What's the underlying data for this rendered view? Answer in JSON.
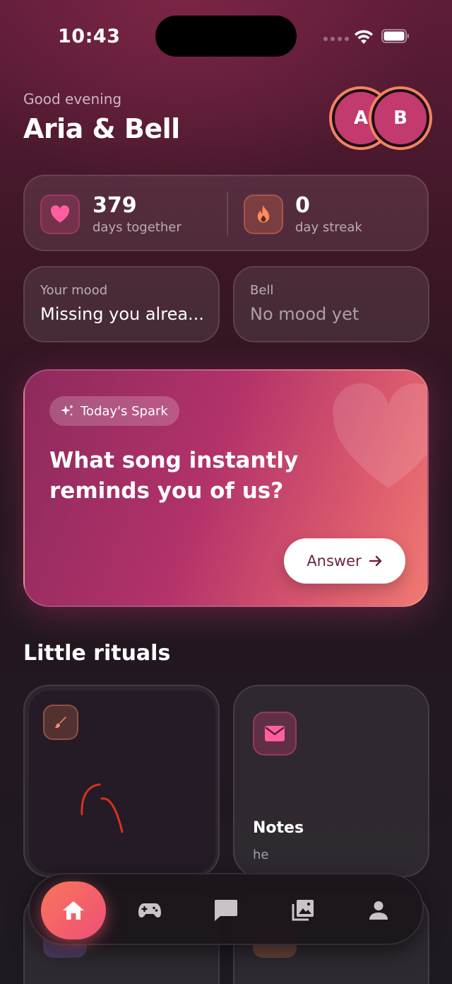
{
  "status_bar": {
    "time": "10:43"
  },
  "header": {
    "greeting": "Good evening",
    "couple_name": "Aria & Bell",
    "avatars": [
      {
        "initial": "A",
        "color": "#c23a6e"
      },
      {
        "initial": "B",
        "color": "#c23a6e"
      }
    ]
  },
  "stats": {
    "days_together": {
      "value": "379",
      "label": "days together",
      "icon": "heart-icon"
    },
    "streak": {
      "value": "0",
      "label": "day streak",
      "icon": "flame-icon"
    }
  },
  "moods": {
    "you": {
      "label": "Your mood",
      "value": "Missing you alrea..."
    },
    "partner": {
      "label": "Bell",
      "value": "No mood yet"
    }
  },
  "spark": {
    "badge": "Today's Spark",
    "question": "What song instantly reminds you of us?",
    "answer_label": "Answer"
  },
  "rituals": {
    "title": "Little rituals",
    "cards": [
      {
        "type": "drawing",
        "icon": "brush-icon"
      },
      {
        "type": "notes",
        "icon": "mail-icon",
        "title": "Notes",
        "preview": "he"
      }
    ]
  },
  "nav": {
    "items": [
      {
        "id": "home",
        "icon": "home-icon",
        "active": true
      },
      {
        "id": "games",
        "icon": "gamepad-icon",
        "active": false
      },
      {
        "id": "chat",
        "icon": "chat-icon",
        "active": false
      },
      {
        "id": "gallery",
        "icon": "gallery-icon",
        "active": false
      },
      {
        "id": "profile",
        "icon": "person-icon",
        "active": false
      }
    ]
  },
  "colors": {
    "accent_pink": "#ec4882",
    "accent_coral": "#f9755b",
    "spark_gradient_start": "#8d2a5d",
    "spark_gradient_end": "#f07a72",
    "background": "#231620"
  }
}
